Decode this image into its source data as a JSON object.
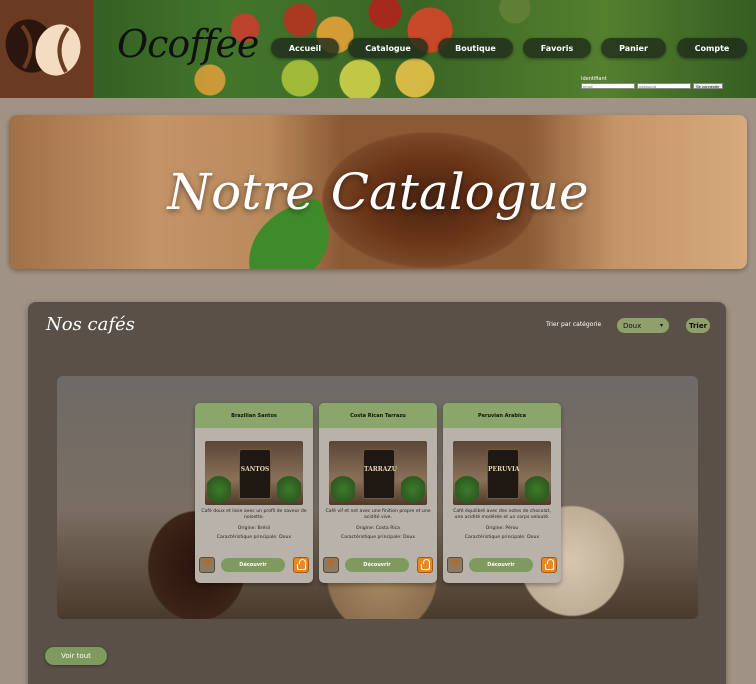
{
  "header": {
    "brand": "Ocoffee",
    "nav": [
      {
        "label": "Accueil"
      },
      {
        "label": "Catalogue"
      },
      {
        "label": "Boutique"
      },
      {
        "label": "Favoris"
      },
      {
        "label": "Panier"
      },
      {
        "label": "Compte"
      }
    ],
    "login": {
      "label": "Identifiant",
      "email_placeholder": "email",
      "password_placeholder": "password",
      "submit_label": "Se connecter"
    }
  },
  "banner": {
    "title": "Notre Catalogue"
  },
  "catalog": {
    "title": "Nos cafés",
    "sort_label": "Trier par catégorie",
    "sort_value": "Doux",
    "sort_button": "Trier",
    "see_all": "Voir tout",
    "cards": [
      {
        "name": "Brazilian Santos",
        "bag_label": "SANTOS",
        "description": "Café doux et lisse avec un profil de saveur de noisette.",
        "origin": "Origine: Brésil",
        "characteristic": "Caractéristique principale: Doux",
        "discover": "Découvrir"
      },
      {
        "name": "Costa Rican Tarrazu",
        "bag_label": "TARRAZU",
        "description": "Café vif et net avec une finition propre et une acidité vive.",
        "origin": "Origine: Costa Rica",
        "characteristic": "Caractéristique principale: Doux",
        "discover": "Découvrir"
      },
      {
        "name": "Peruvian Arabica",
        "bag_label": "PERUVIA",
        "description": "Café équilibré avec des notes de chocolat, une acidité modérée et un corps velouté.",
        "origin": "Origine: Pérou",
        "characteristic": "Caractéristique principale: Doux",
        "discover": "Découvrir"
      }
    ]
  }
}
